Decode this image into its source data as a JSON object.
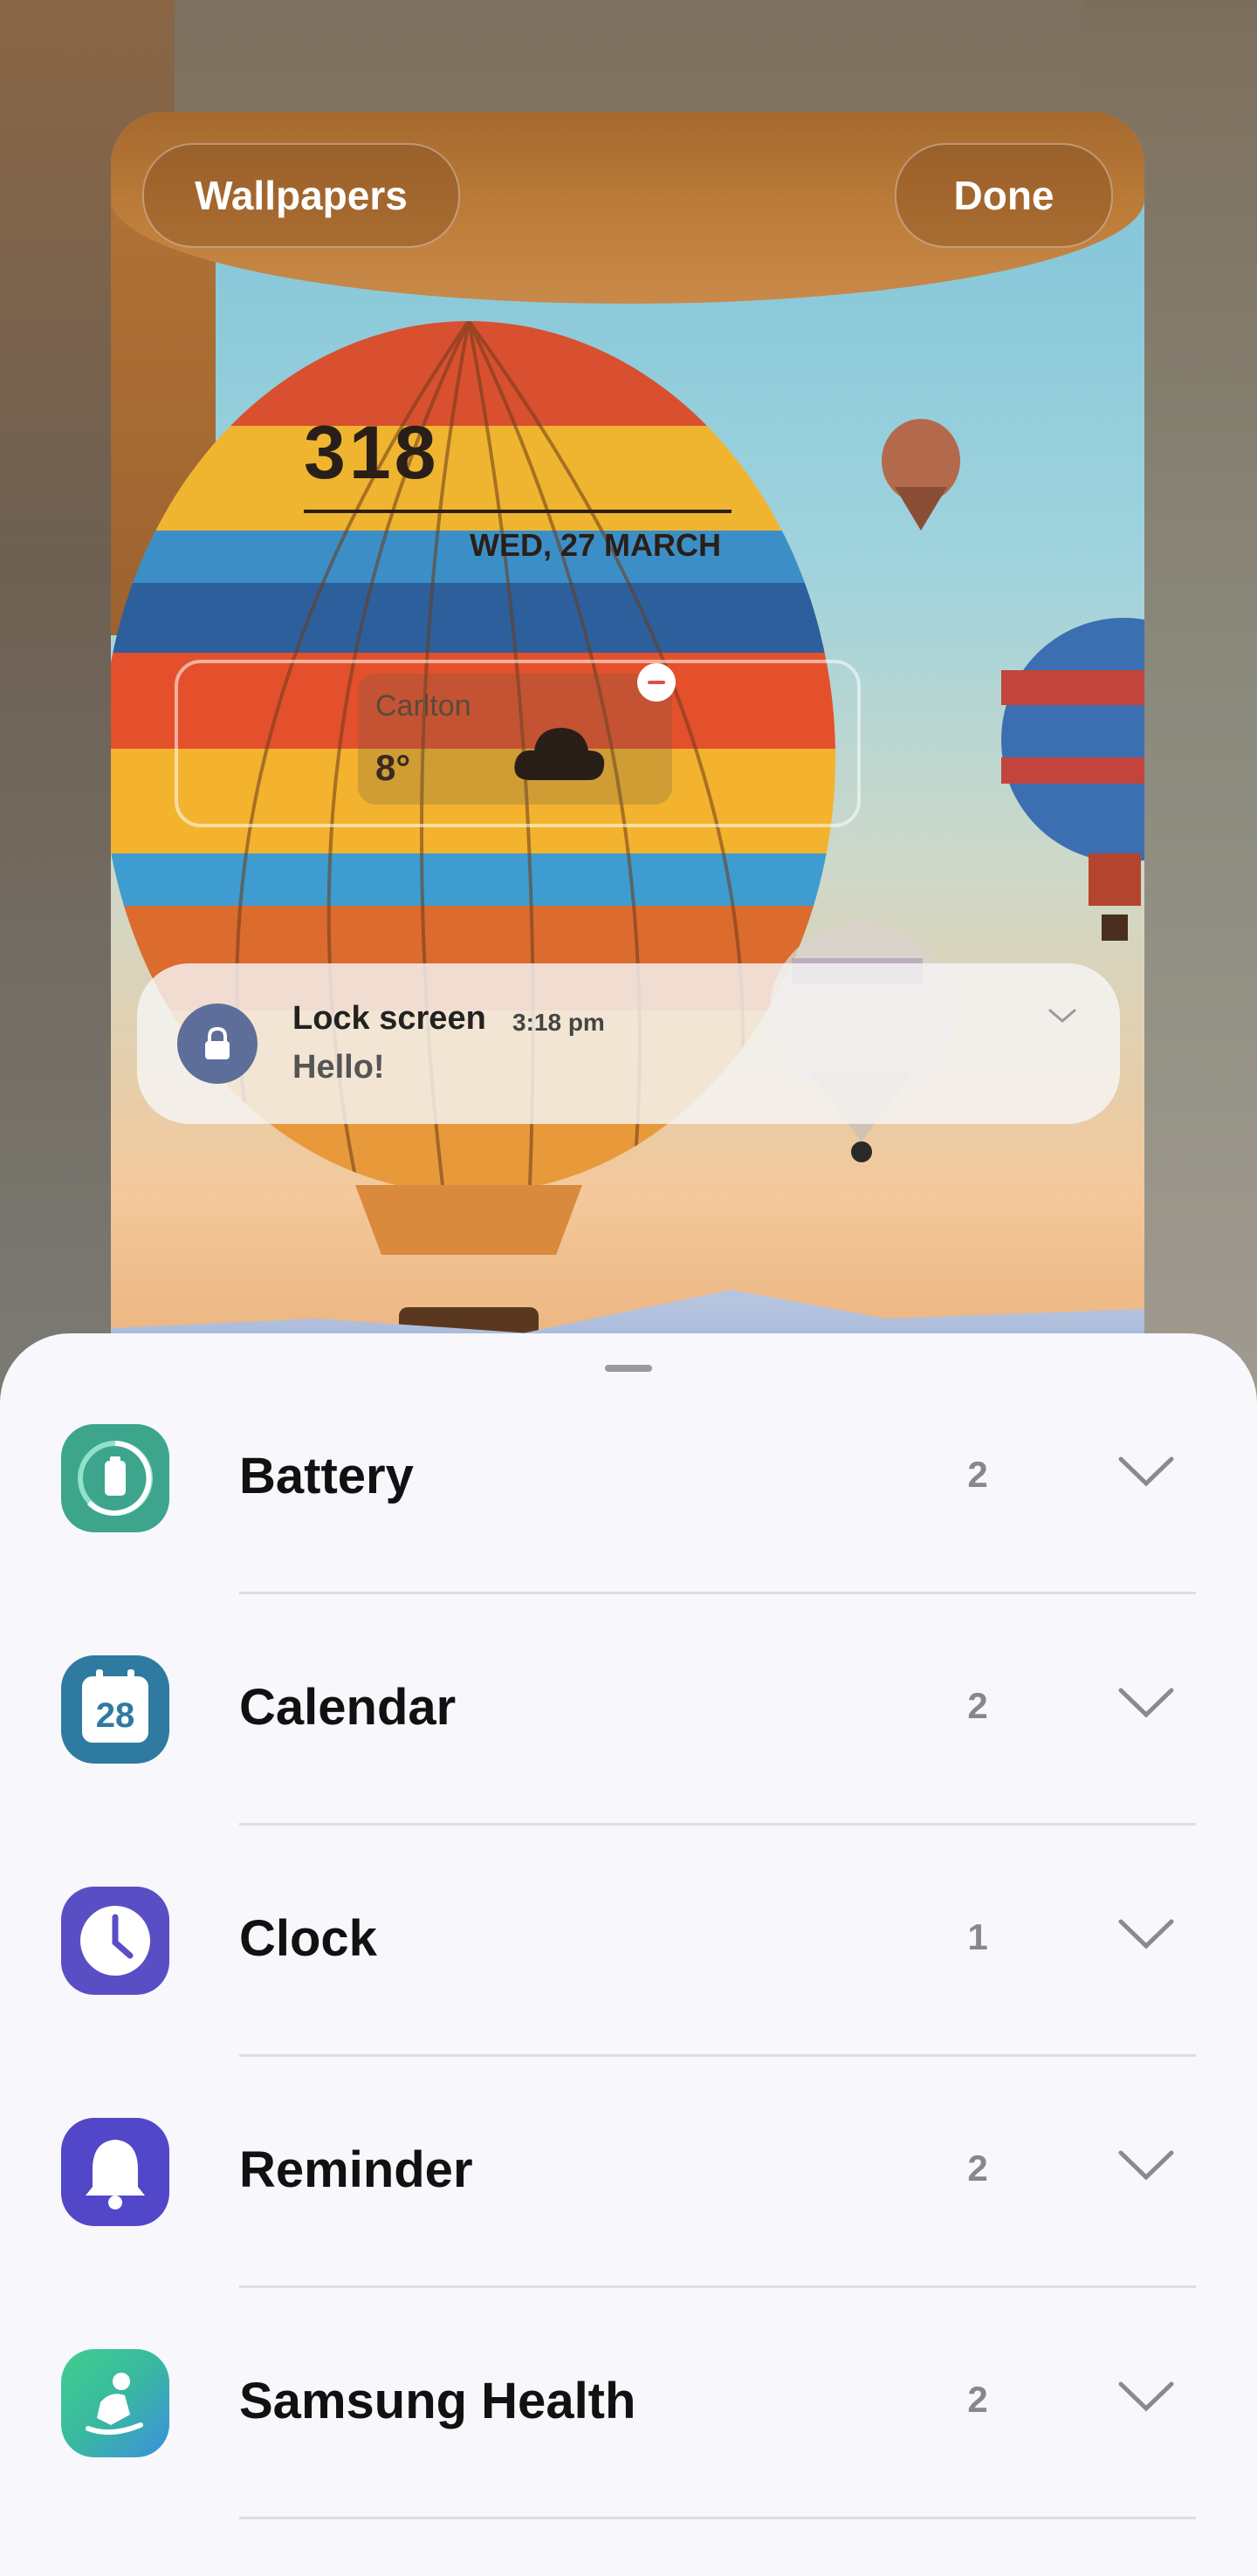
{
  "preview": {
    "wallpapers_label": "Wallpapers",
    "done_label": "Done",
    "clock_time": "318",
    "clock_date": "WED, 27 MARCH",
    "weather": {
      "city": "Carlton",
      "temp": "8°",
      "icon": "cloud-icon"
    }
  },
  "notification": {
    "app_name": "Lock screen",
    "time": "3:18 pm",
    "message": "Hello!",
    "icon": "lock-icon"
  },
  "sheet": {
    "apps": [
      {
        "name": "Battery",
        "count": "2",
        "icon": "battery-icon",
        "color": "#3da58c"
      },
      {
        "name": "Calendar",
        "count": "2",
        "icon": "calendar-icon",
        "icon_text": "28",
        "color": "#2f7aa0"
      },
      {
        "name": "Clock",
        "count": "1",
        "icon": "clock-icon",
        "color": "#5a4ec4"
      },
      {
        "name": "Reminder",
        "count": "2",
        "icon": "bell-icon",
        "color": "#5247c8"
      },
      {
        "name": "Samsung Health",
        "count": "2",
        "icon": "health-icon",
        "color": "#39b8a0"
      }
    ]
  }
}
